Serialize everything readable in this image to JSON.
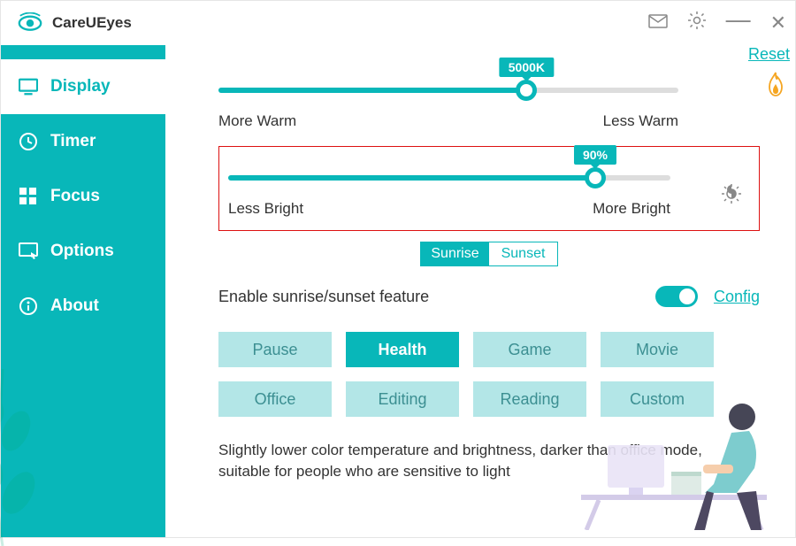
{
  "app": {
    "title": "CareUEyes"
  },
  "sidebar": {
    "items": [
      {
        "label": "Display"
      },
      {
        "label": "Timer"
      },
      {
        "label": "Focus"
      },
      {
        "label": "Options"
      },
      {
        "label": "About"
      }
    ],
    "active_index": 0
  },
  "color_temp": {
    "value_label": "5000K",
    "percent": 67,
    "left_label": "More Warm",
    "right_label": "Less Warm",
    "reset_label": "Reset"
  },
  "brightness": {
    "value_label": "90%",
    "percent": 83,
    "left_label": "Less Bright",
    "right_label": "More Bright"
  },
  "segmented": {
    "sunrise": "Sunrise",
    "sunset": "Sunset",
    "active": "sunrise"
  },
  "enable": {
    "label": "Enable sunrise/sunset feature",
    "toggle_on": true,
    "config_label": "Config"
  },
  "modes": [
    "Pause",
    "Health",
    "Game",
    "Movie",
    "Office",
    "Editing",
    "Reading",
    "Custom"
  ],
  "modes_active_index": 1,
  "description": "Slightly lower color temperature and brightness, darker than office mode, suitable for people who are sensitive to light",
  "colors": {
    "accent": "#08b7b9"
  }
}
